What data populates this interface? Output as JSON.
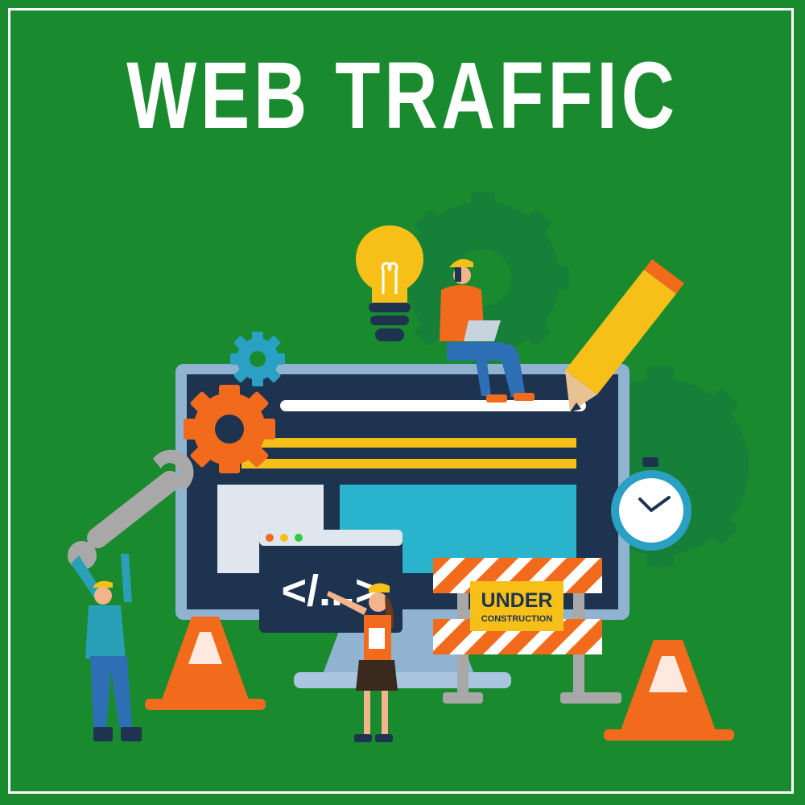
{
  "title": "WEB TRAFFIC",
  "sign": {
    "line1": "UNDER",
    "line2": "CONSTRUCTION"
  },
  "code_window": {
    "code_text": "</...>"
  },
  "colors": {
    "background": "#1a8a2e",
    "monitor_frame": "#7fa8c9",
    "screen": "#1e3350",
    "accent_yellow": "#f6c018",
    "accent_orange": "#f26a1b",
    "cyan": "#29b3cc"
  },
  "icons": [
    "gear-icon",
    "lightbulb-icon",
    "pencil-icon",
    "wrench-icon",
    "stopwatch-icon",
    "traffic-cone-icon",
    "barrier-icon",
    "code-window-icon"
  ]
}
